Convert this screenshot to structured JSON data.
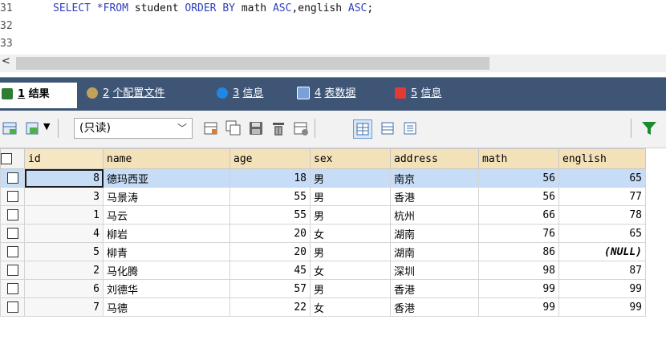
{
  "editor": {
    "lines": [
      {
        "num": "31",
        "tokens": [
          {
            "t": "SELECT *FROM",
            "k": true
          },
          {
            "t": " student ",
            "k": false
          },
          {
            "t": "ORDER BY",
            "k": true
          },
          {
            "t": " math ",
            "k": false
          },
          {
            "t": "ASC",
            "k": true
          },
          {
            "t": ",english ",
            "k": false
          },
          {
            "t": "ASC",
            "k": true
          },
          {
            "t": ";",
            "k": false
          }
        ]
      },
      {
        "num": "32",
        "tokens": []
      },
      {
        "num": "33",
        "tokens": []
      }
    ],
    "scroll_arrow": "<"
  },
  "tabs": [
    {
      "num": "1",
      "label": "结果",
      "icon": "results-icon",
      "color": "#2e7d32"
    },
    {
      "num": "2",
      "label": "个配置文件",
      "icon": "profile-icon",
      "color": "#c2a25a"
    },
    {
      "num": "3",
      "label": "信息",
      "icon": "info-icon",
      "color": "#1e88e5"
    },
    {
      "num": "4",
      "label": "表数据",
      "icon": "table-data-icon",
      "color": "#7aa0d8"
    },
    {
      "num": "5",
      "label": "信息",
      "icon": "info-chart-icon",
      "color": "#e53935"
    }
  ],
  "toolbar": {
    "mode_select": "(只读)"
  },
  "grid": {
    "columns": [
      "id",
      "name",
      "age",
      "sex",
      "address",
      "math",
      "english"
    ],
    "rows": [
      [
        "8",
        "德玛西亚",
        "18",
        "男",
        "南京",
        "56",
        "65"
      ],
      [
        "3",
        "马景涛",
        "55",
        "男",
        "香港",
        "56",
        "77"
      ],
      [
        "1",
        "马云",
        "55",
        "男",
        "杭州",
        "66",
        "78"
      ],
      [
        "4",
        "柳岩",
        "20",
        "女",
        "湖南",
        "76",
        "65"
      ],
      [
        "5",
        "柳青",
        "20",
        "男",
        "湖南",
        "86",
        "(NULL)"
      ],
      [
        "2",
        "马化腾",
        "45",
        "女",
        "深圳",
        "98",
        "87"
      ],
      [
        "6",
        "刘德华",
        "57",
        "男",
        "香港",
        "99",
        "99"
      ],
      [
        "7",
        "马德",
        "22",
        "女",
        "香港",
        "99",
        "99"
      ]
    ],
    "selected_row": 0
  }
}
